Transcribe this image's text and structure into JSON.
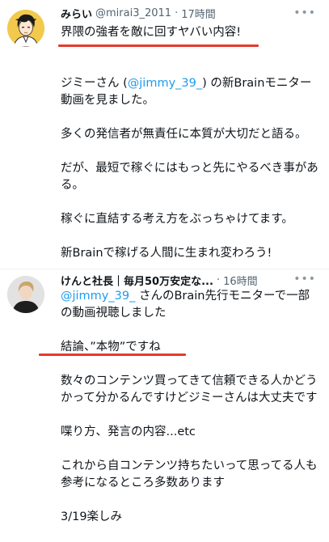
{
  "tweet1": {
    "name": "みらい",
    "handle": "@mirai3_2011",
    "separator": "·",
    "time": "17時間",
    "more": "•••",
    "highlight": "界隈の強者を敵に回すヤバい内容!",
    "p1_pre": "ジミーさん (",
    "p1_mention": "@jimmy_39_",
    "p1_post": ") の新Brainモニター動画を見ました。",
    "p2": "多くの発信者が無責任に本質が大切だと語る。",
    "p3": "だが、最短で稼ぐにはもっと先にやるべき事がある。",
    "p4": "稼ぐに直結する考え方をぶっちゃけてます。",
    "p5": "新Brainで稼げる人間に生まれ変わろう!"
  },
  "tweet2": {
    "name": "けんと社長｜毎月50万安定な...",
    "separator": "·",
    "time": "16時間",
    "more": "•••",
    "p1_mention": "@jimmy_39_",
    "p1_post": " さんのBrain先行モニターで一部の動画視聴しました",
    "p2": "結論、”本物”ですね",
    "p3": "数々のコンテンツ買ってきて信頼できる人かどうかって分かるんですけどジミーさんは大丈夫です",
    "p4": "喋り方、発言の内容...etc",
    "p5": "これから自コンテンツ持ちたいって思ってる人も参考になるところ多数あります",
    "p6": "3/19楽しみ"
  },
  "colors": {
    "link": "#1d9bf0",
    "underline": "#e63a2c",
    "meta": "#536471"
  }
}
